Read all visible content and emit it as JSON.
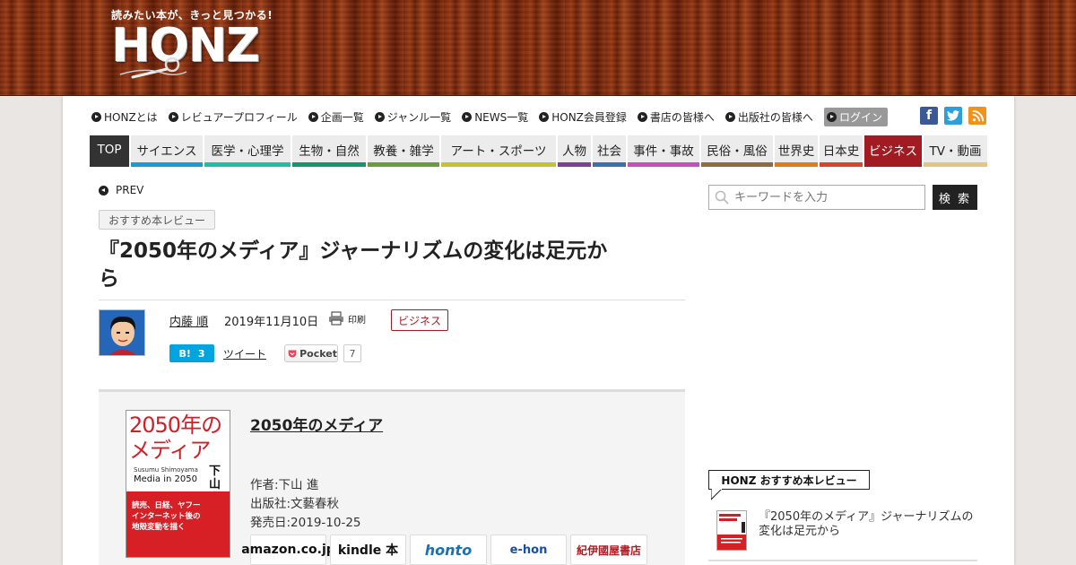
{
  "header": {
    "tagline": "読みたい本が、きっと見つかる!",
    "logo_text": "HONZ"
  },
  "utility_nav": {
    "items": [
      "HONZとは",
      "レビュアープロフィール",
      "企画一覧",
      "ジャンル一覧",
      "NEWS一覧",
      "HONZ会員登録",
      "書店の皆様へ",
      "出版社の皆様へ"
    ],
    "login": "ログイン"
  },
  "social": {
    "facebook": "f",
    "twitter": "t",
    "rss": "rss"
  },
  "categories": [
    {
      "label": "TOP",
      "color": "#333333"
    },
    {
      "label": "サイエンス",
      "color": "#1a9bd7"
    },
    {
      "label": "医学・心理学",
      "color": "#1dbfa6"
    },
    {
      "label": "生物・自然",
      "color": "#14956b"
    },
    {
      "label": "教養・雑学",
      "color": "#6a9b3c"
    },
    {
      "label": "アート・スポーツ",
      "color": "#c4c132"
    },
    {
      "label": "人物",
      "color": "#7d3f98"
    },
    {
      "label": "社会",
      "color": "#3a6fb3"
    },
    {
      "label": "事件・事故",
      "color": "#c64fbd"
    },
    {
      "label": "民俗・風俗",
      "color": "#8f6b42"
    },
    {
      "label": "世界史",
      "color": "#e07b1d"
    },
    {
      "label": "日本史",
      "color": "#d8462a"
    },
    {
      "label": "ビジネス",
      "color": "#a31b22"
    },
    {
      "label": "TV・動画",
      "color": "#e0c682"
    }
  ],
  "article": {
    "prev_label": "PREV",
    "tag": "おすすめ本レビュー",
    "title_line1": "『2050年のメディア』ジャーナリズムの変化は足元か",
    "title_line2": "ら",
    "author": "内藤 順",
    "date": "2019年11月10日",
    "print_label": "印刷",
    "category": "ビジネス",
    "hatena_label": "B!",
    "hatena_count": "3",
    "tweet_label": "ツイート",
    "pocket_label": "Pocket",
    "pocket_count": "7"
  },
  "book": {
    "title": "2050年のメディア",
    "author": "作者:下山 進",
    "publisher": "出版社:文藝春秋",
    "release": "発売日:2019-10-25",
    "cover": {
      "title_line1": "2050年の",
      "title_line2": "メディア",
      "author_vertical": "下山進",
      "en_author": "Susumu Shimoyama",
      "en_title": "Media in 2050",
      "blurb1": "読売、日経、ヤフー",
      "blurb2": "インターネット後の",
      "blurb3": "地殻変動を描く"
    },
    "stores": [
      "amazon.co.jp",
      "kindle 本",
      "honto",
      "e-hon",
      "紀伊國屋書店"
    ]
  },
  "sidebar": {
    "search_placeholder": "キーワードを入力",
    "search_button": "検 索",
    "heading": "HONZ おすすめ本レビュー",
    "recommended_title": "『2050年のメディア』ジャーナリズムの変化は足元から"
  }
}
